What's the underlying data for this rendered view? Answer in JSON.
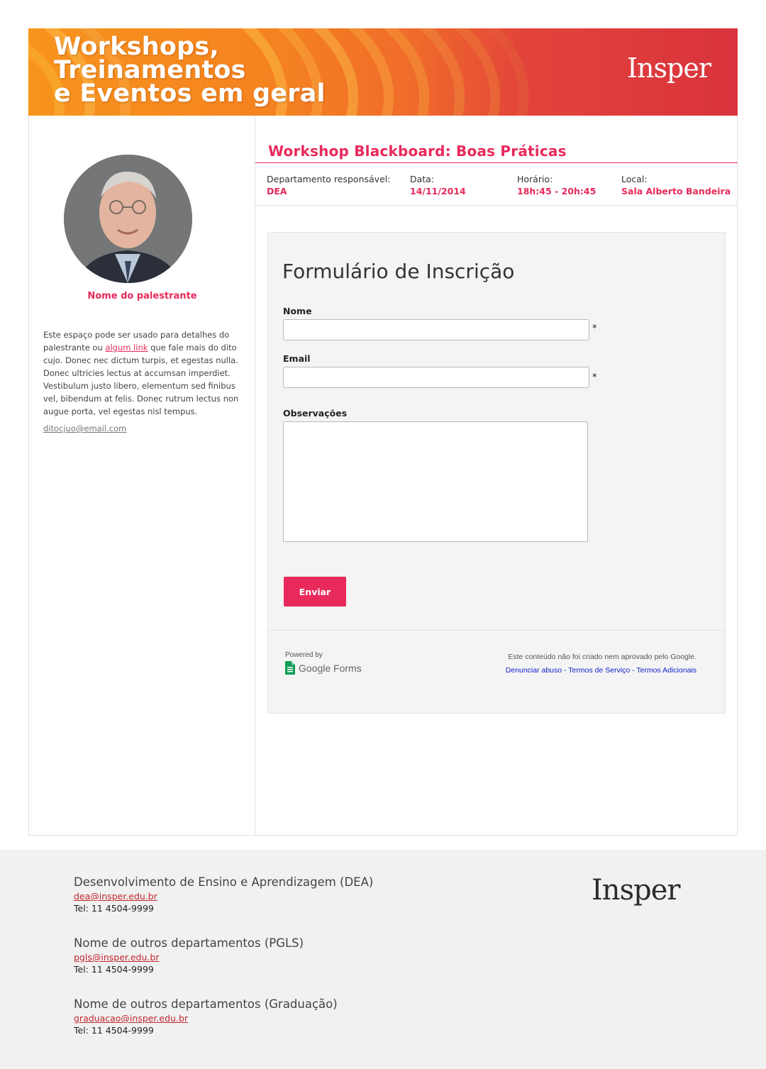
{
  "banner": {
    "title_lines": [
      "Workshops,",
      "Treinamentos",
      "e Eventos em geral"
    ],
    "logo": "Insper"
  },
  "speaker": {
    "name": "Nome do palestrante",
    "bio_before_link": "Este espaço pode ser usado para detalhes do palestrante ou ",
    "bio_link": "algum link",
    "bio_after_link": " que fale mais do dito cujo. Donec nec dictum turpis, et egestas nulla. Donec ultricies lectus at accumsan imperdiet. Vestibulum justo libero, elementum sed finibus vel, bibendum at felis. Donec rutrum lectus non augue porta, vel egestas nisl tempus.",
    "email": "ditocjuo@email.com"
  },
  "event": {
    "title": "Workshop Blackboard: Boas Práticas",
    "meta": [
      {
        "label": "Departamento responsável:",
        "value": "DEA"
      },
      {
        "label": "Data:",
        "value": "14/11/2014"
      },
      {
        "label": "Horário:",
        "value": "18h:45 - 20h:45"
      },
      {
        "label": "Local:",
        "value": "Sala Alberto Bandeira"
      }
    ]
  },
  "form": {
    "title": "Formulário de Inscrição",
    "fields": {
      "name_label": "Nome",
      "email_label": "Email",
      "notes_label": "Observações",
      "required_mark": "*"
    },
    "submit_label": "Enviar",
    "powered_by": "Powered by",
    "google_forms": "Google Forms",
    "disclaimer": "Este conteúdo não foi criado nem aprovado pelo Google.",
    "links": [
      "Denunciar abuso",
      "Termos de Serviço",
      "Termos Adicionais"
    ],
    "link_separator": " - "
  },
  "footer": {
    "logo": "Insper",
    "departments": [
      {
        "name": "Desenvolvimento de Ensino e Aprendizagem (DEA)",
        "email": "dea@insper.edu.br",
        "tel": "Tel: 11 4504-9999"
      },
      {
        "name": "Nome de outros departamentos (PGLS)",
        "email": "pgls@insper.edu.br",
        "tel": "Tel: 11 4504-9999"
      },
      {
        "name": "Nome de outros departamentos (Graduação)",
        "email": "graduacao@insper.edu.br",
        "tel": "Tel: 11 4504-9999"
      }
    ]
  },
  "colors": {
    "accent": "#e8295c",
    "banner_orange": "#f58220",
    "banner_red": "#d9333d",
    "footer_bg": "#f1f1f1",
    "link_red": "#c1272d"
  }
}
